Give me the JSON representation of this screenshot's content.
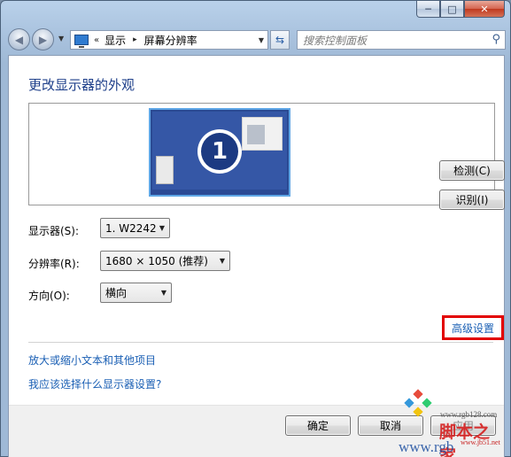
{
  "window": {
    "controls": {
      "minimize": "─",
      "maximize": "□",
      "close": "✕"
    }
  },
  "nav": {
    "back_icon": "left-arrow-icon",
    "forward_icon": "right-arrow-icon",
    "address": {
      "icon": "display-icon",
      "chevrons": "«",
      "crumbs": [
        "显示",
        "屏幕分辨率"
      ],
      "separator": "▸",
      "dropdown": "▼"
    },
    "refresh_icon": "refresh-icon",
    "search": {
      "placeholder": "搜索控制面板"
    }
  },
  "page": {
    "title": "更改显示器的外观",
    "monitor_number": "1",
    "buttons": {
      "detect": "检测(C)",
      "identify": "识别(I)"
    },
    "fields": {
      "display": {
        "label": "显示器(S):",
        "value": "1. W2242"
      },
      "resolution": {
        "label": "分辨率(R):",
        "value": "1680 × 1050 (推荐)"
      },
      "orientation": {
        "label": "方向(O):",
        "value": "横向"
      }
    },
    "advanced_link": "高级设置",
    "links": {
      "text_size": "放大或缩小文本和其他项目",
      "which_settings": "我应该选择什么显示器设置?"
    }
  },
  "footer": {
    "ok": "确定",
    "cancel": "取消",
    "apply": "应用"
  },
  "watermark": {
    "url": "www.rgb128.com",
    "brand": "脚本之家",
    "url2": "www.jb51.net",
    "big": "www.rgb"
  },
  "colors": {
    "title_blue": "#1e3f8a",
    "link_blue": "#1a5fb4",
    "highlight_red": "#e20000",
    "monitor_blue": "#3557a6"
  }
}
